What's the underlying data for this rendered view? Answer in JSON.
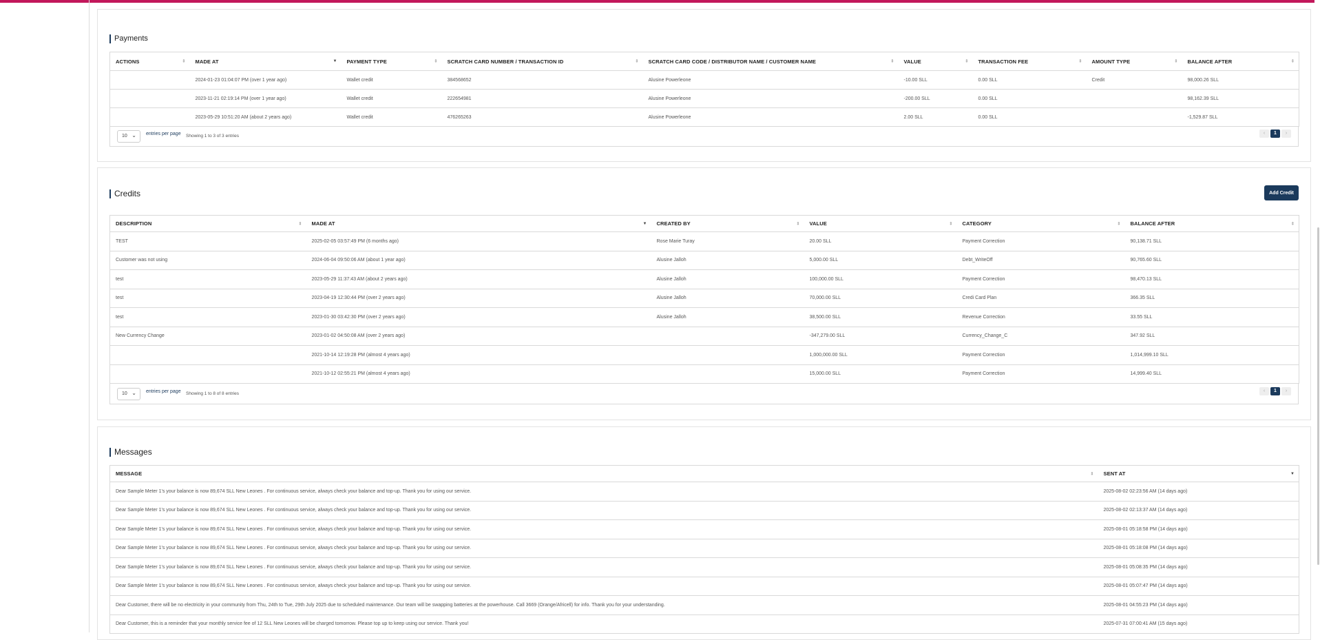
{
  "payments": {
    "title": "Payments",
    "columns": [
      "ACTIONS",
      "MADE AT",
      "PAYMENT TYPE",
      "SCRATCH CARD NUMBER / TRANSACTION ID",
      "SCRATCH CARD CODE / DISTRIBUTOR NAME / CUSTOMER NAME",
      "VALUE",
      "TRANSACTION FEE",
      "AMOUNT TYPE",
      "BALANCE AFTER"
    ],
    "rows": [
      [
        "",
        "2024-01-23 01:04:07 PM (over 1 year ago)",
        "Wallet credit",
        "384568652",
        "Alusine Powerleone",
        "-10.00 SLL",
        "0.00 SLL",
        "Credit",
        "98,000.26 SLL"
      ],
      [
        "",
        "2023-11-21 02:19:14 PM (over 1 year ago)",
        "Wallet credit",
        "222654981",
        "Alusine Powerleone",
        "-200.00 SLL",
        "0.00 SLL",
        "",
        "98,162.39 SLL"
      ],
      [
        "",
        "2023-05-29 10:51:20 AM (about 2 years ago)",
        "Wallet credit",
        "476265263",
        "Alusine Powerleone",
        "2.00 SLL",
        "0.00 SLL",
        "",
        "-1,529.87 SLL"
      ]
    ],
    "per_page": "10",
    "per_page_label": "entries per page",
    "showing": "Showing 1 to 3 of 3 entries",
    "current_page": "1",
    "prev": "‹",
    "next": "›"
  },
  "credits": {
    "title": "Credits",
    "add_button": "Add Credit",
    "columns": [
      "DESCRIPTION",
      "MADE AT",
      "CREATED BY",
      "VALUE",
      "CATEGORY",
      "BALANCE AFTER"
    ],
    "rows": [
      [
        "TEST",
        "2025-02-05 03:57:49 PM (6 months ago)",
        "Rose Marie Turay",
        "20.00 SLL",
        "Payment Correction",
        "90,138.71 SLL"
      ],
      [
        "Customer was not using",
        "2024-06-04 09:50:06 AM (about 1 year ago)",
        "Alusine Jalloh",
        "5,000.00 SLL",
        "Debt_WriteOff",
        "90,765.60 SLL"
      ],
      [
        "test",
        "2023-05-29 11:37:43 AM (about 2 years ago)",
        "Alusine Jalloh",
        "100,000.00 SLL",
        "Payment Correction",
        "98,470.13 SLL"
      ],
      [
        "test",
        "2023-04-19 12:30:44 PM (over 2 years ago)",
        "Alusine Jalloh",
        "70,000.00 SLL",
        "Credi Card Plan",
        "366.35 SLL"
      ],
      [
        "test",
        "2023-01-30 03:42:30 PM (over 2 years ago)",
        "Alusine Jalloh",
        "38,500.00 SLL",
        "Revenue Correction",
        "33.55 SLL"
      ],
      [
        "New Currency Change",
        "2023-01-02 04:50:08 AM (over 2 years ago)",
        "",
        "-347,279.00 SLL",
        "Currency_Change_C",
        "347.92 SLL"
      ],
      [
        "",
        "2021-10-14 12:19:28 PM (almost 4 years ago)",
        "",
        "1,000,000.00 SLL",
        "Payment Correction",
        "1,014,999.10 SLL"
      ],
      [
        "",
        "2021-10-12 02:55:21 PM (almost 4 years ago)",
        "",
        "15,000.00 SLL",
        "Payment Correction",
        "14,999.40 SLL"
      ]
    ],
    "per_page": "10",
    "per_page_label": "entries per page",
    "showing": "Showing 1 to 8 of 8 entries",
    "current_page": "1",
    "prev": "‹",
    "next": "›"
  },
  "messages": {
    "title": "Messages",
    "columns": [
      "MESSAGE",
      "SENT AT"
    ],
    "rows": [
      [
        "Dear Sample Meter 1's your balance is now 89,674 SLL New Leones . For continuous service, always check your balance and top-up. Thank you for using our service.",
        "2025-08-02 02:23:56 AM (14 days ago)"
      ],
      [
        "Dear Sample Meter 1's your balance is now 89,674 SLL New Leones . For continuous service, always check your balance and top-up. Thank you for using our service.",
        "2025-08-02 02:13:37 AM (14 days ago)"
      ],
      [
        "Dear Sample Meter 1's your balance is now 89,674 SLL New Leones . For continuous service, always check your balance and top-up. Thank you for using our service.",
        "2025-08-01 05:18:58 PM (14 days ago)"
      ],
      [
        "Dear Sample Meter 1's your balance is now 89,674 SLL New Leones . For continuous service, always check your balance and top-up. Thank you for using our service.",
        "2025-08-01 05:18:08 PM (14 days ago)"
      ],
      [
        "Dear Sample Meter 1's your balance is now 89,674 SLL New Leones . For continuous service, always check your balance and top-up. Thank you for using our service.",
        "2025-08-01 05:08:35 PM (14 days ago)"
      ],
      [
        "Dear Sample Meter 1's your balance is now 89,674 SLL New Leones . For continuous service, always check your balance and top-up. Thank you for using our service.",
        "2025-08-01 05:07:47 PM (14 days ago)"
      ],
      [
        "Dear Customer, there will be no electricity in your community from Thu, 24th to Tue, 29th July 2025 due to scheduled maintenance. Our team will be swapping batteries at the powerhouse. Call 3669 (Orange/Africell) for info. Thank you for your understanding.",
        "2025-08-01 04:55:23 PM (14 days ago)"
      ],
      [
        "Dear Customer, this is a reminder that your monthly service fee of 12 SLL New Leones will be charged tomorrow. Please top up to keep using our service. Thank you!",
        "2025-07-31 07:00:41 AM (15 days ago)"
      ]
    ]
  },
  "sort_icons": {
    "unsorted": "⇕",
    "desc": "▼"
  },
  "colors": {
    "accent": "#1b3a5c",
    "top_bar": "#c2185b",
    "negative": "#e53935"
  }
}
